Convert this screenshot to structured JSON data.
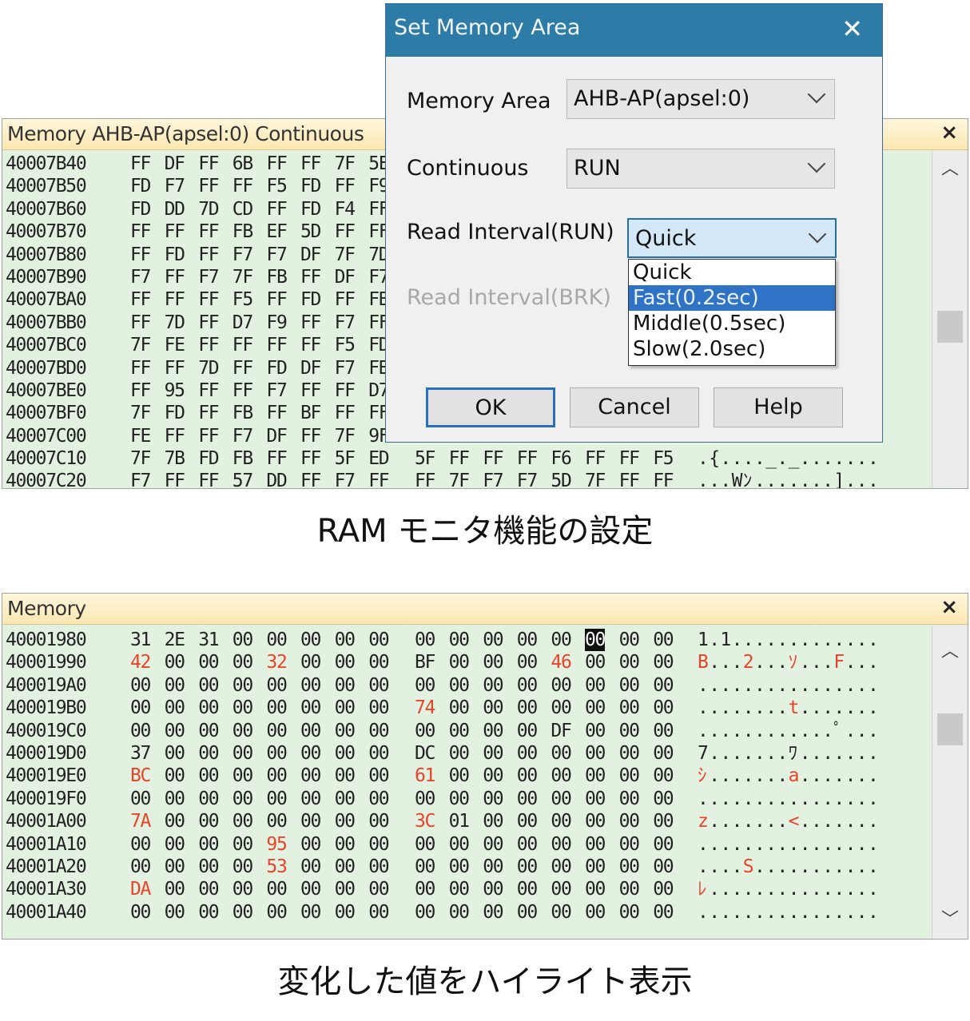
{
  "panel1": {
    "title": "Memory AHB-AP(apsel:0)  Continuous",
    "close": "×",
    "rows": [
      {
        "addr": "40007B40",
        "a": "FF DF FF 6B FF FF 7F 5E"
      },
      {
        "addr": "40007B50",
        "a": "FD F7 FF FF F5 FD FF F9"
      },
      {
        "addr": "40007B60",
        "a": "FD DD 7D CD FF FD F4 FF"
      },
      {
        "addr": "40007B70",
        "a": "FF FF FF FB EF 5D FF FF"
      },
      {
        "addr": "40007B80",
        "a": "FF FD FF F7 F7 DF 7F 7D"
      },
      {
        "addr": "40007B90",
        "a": "F7 FF F7 7F FB FF DF F7"
      },
      {
        "addr": "40007BA0",
        "a": "FF FF FF F5 FF FD FF FB"
      },
      {
        "addr": "40007BB0",
        "a": "FF 7D FF D7 F9 FF F7 FF"
      },
      {
        "addr": "40007BC0",
        "a": "7F FE FF FF FF FF F5 FD"
      },
      {
        "addr": "40007BD0",
        "a": "FF FF 7D FF FD DF F7 FB"
      },
      {
        "addr": "40007BE0",
        "a": "FF 95 FF FF F7 FF FF D7"
      },
      {
        "addr": "40007BF0",
        "a": "7F FD FF FB FF BF FF FF"
      },
      {
        "addr": "40007C00",
        "a": "FE FF FF F7 DF FF 7F 9F"
      },
      {
        "addr": "40007C10",
        "a": "7F 7B FD FB FF FF 5F ED",
        "b": "5F FF FF FF F6 FF FF F5",
        "ascii": ".{...._._......."
      },
      {
        "addr": "40007C20",
        "a": "F7 FF FF 57 DD FF F7 FF",
        "b": "FF 7F F7 F7 5D 7F FF FF",
        "ascii": "...Wﾝ.......]..."
      }
    ]
  },
  "caption1": "RAM モニタ機能の設定",
  "dialog": {
    "title": "Set Memory Area",
    "close": "✕",
    "memory_area_label": "Memory Area",
    "memory_area_value": "AHB-AP(apsel:0)",
    "continuous_label": "Continuous",
    "continuous_value": "RUN",
    "read_interval_run_label": "Read Interval(RUN)",
    "read_interval_run_value": "Quick",
    "read_interval_brk_label": "Read Interval(BRK)",
    "options": [
      "Quick",
      "Fast(0.2sec)",
      "Middle(0.5sec)",
      "Slow(2.0sec)"
    ],
    "selected_option": "Fast(0.2sec)",
    "ok_label": "OK",
    "cancel_label": "Cancel",
    "help_label": "Help"
  },
  "panel2": {
    "title": "Memory",
    "close": "×",
    "rows": [
      {
        "addr": "40001980",
        "a": "31 2E 31 00 00 00 00 00",
        "b": "00 00 00 00 00 00 00 00",
        "ascii": "1.1............."
      },
      {
        "addr": "40001990",
        "a": "42 00 00 00 32 00 00 00",
        "b": "BF 00 00 00 46 00 00 00",
        "ascii": "B...2...ｿ...F..."
      },
      {
        "addr": "400019A0",
        "a": "00 00 00 00 00 00 00 00",
        "b": "00 00 00 00 00 00 00 00",
        "ascii": "................"
      },
      {
        "addr": "400019B0",
        "a": "00 00 00 00 00 00 00 00",
        "b": "74 00 00 00 00 00 00 00",
        "ascii": "........t......."
      },
      {
        "addr": "400019C0",
        "a": "00 00 00 00 00 00 00 00",
        "b": "00 00 00 00 DF 00 00 00",
        "ascii": "............ﾟ..."
      },
      {
        "addr": "400019D0",
        "a": "37 00 00 00 00 00 00 00",
        "b": "DC 00 00 00 00 00 00 00",
        "ascii": "7.......ﾜ......."
      },
      {
        "addr": "400019E0",
        "a": "BC 00 00 00 00 00 00 00",
        "b": "61 00 00 00 00 00 00 00",
        "ascii": "ｼ.......a......."
      },
      {
        "addr": "400019F0",
        "a": "00 00 00 00 00 00 00 00",
        "b": "00 00 00 00 00 00 00 00",
        "ascii": "................"
      },
      {
        "addr": "40001A00",
        "a": "7A 00 00 00 00 00 00 00",
        "b": "3C 01 00 00 00 00 00 00",
        "ascii": "z.......<......."
      },
      {
        "addr": "40001A10",
        "a": "00 00 00 00 95 00 00 00",
        "b": "00 00 00 00 00 00 00 00",
        "ascii": "................"
      },
      {
        "addr": "40001A20",
        "a": "00 00 00 00 53 00 00 00",
        "b": "00 00 00 00 00 00 00 00",
        "ascii": "....S..........."
      },
      {
        "addr": "40001A30",
        "a": "DA 00 00 00 00 00 00 00",
        "b": "00 00 00 00 00 00 00 00",
        "ascii": "ﾚ..............."
      },
      {
        "addr": "40001A40",
        "a": "00 00 00 00 00 00 00 00",
        "b": "00 00 00 00 00 00 00 00",
        "ascii": "................"
      }
    ],
    "highlight_color": "#e8442a"
  },
  "caption2": "変化した値をハイライト表示"
}
